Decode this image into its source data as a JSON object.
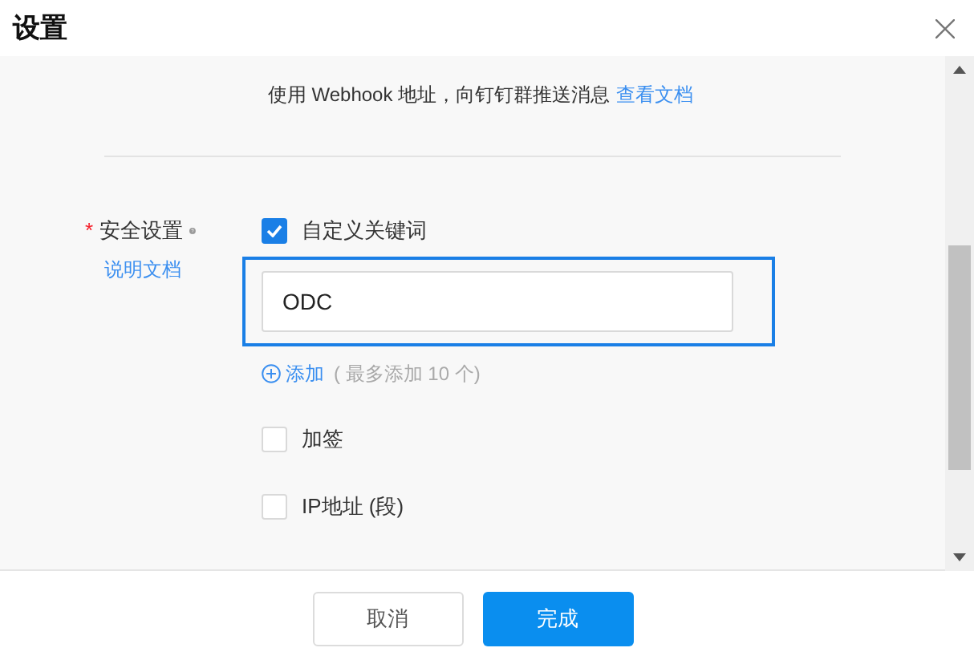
{
  "dialog": {
    "title": "设置"
  },
  "intro": {
    "text": "使用 Webhook 地址，向钉钉群推送消息",
    "link": "查看文档"
  },
  "security": {
    "required_mark": "*",
    "label": "安全设置",
    "help_link": "说明文档",
    "options": [
      {
        "kind": "keywords",
        "label": "自定义关键词",
        "checked": true,
        "highlighted": true,
        "keywords": [
          "ODC"
        ],
        "add_link": "添加",
        "add_hint": "( 最多添加 10 个)"
      },
      {
        "kind": "plain",
        "label": "加签",
        "checked": false
      },
      {
        "kind": "plain",
        "label": "IP地址 (段)",
        "checked": false
      }
    ]
  },
  "buttons": [
    {
      "kind": "secondary",
      "label": "取消"
    },
    {
      "kind": "primary",
      "label": "完成"
    }
  ]
}
